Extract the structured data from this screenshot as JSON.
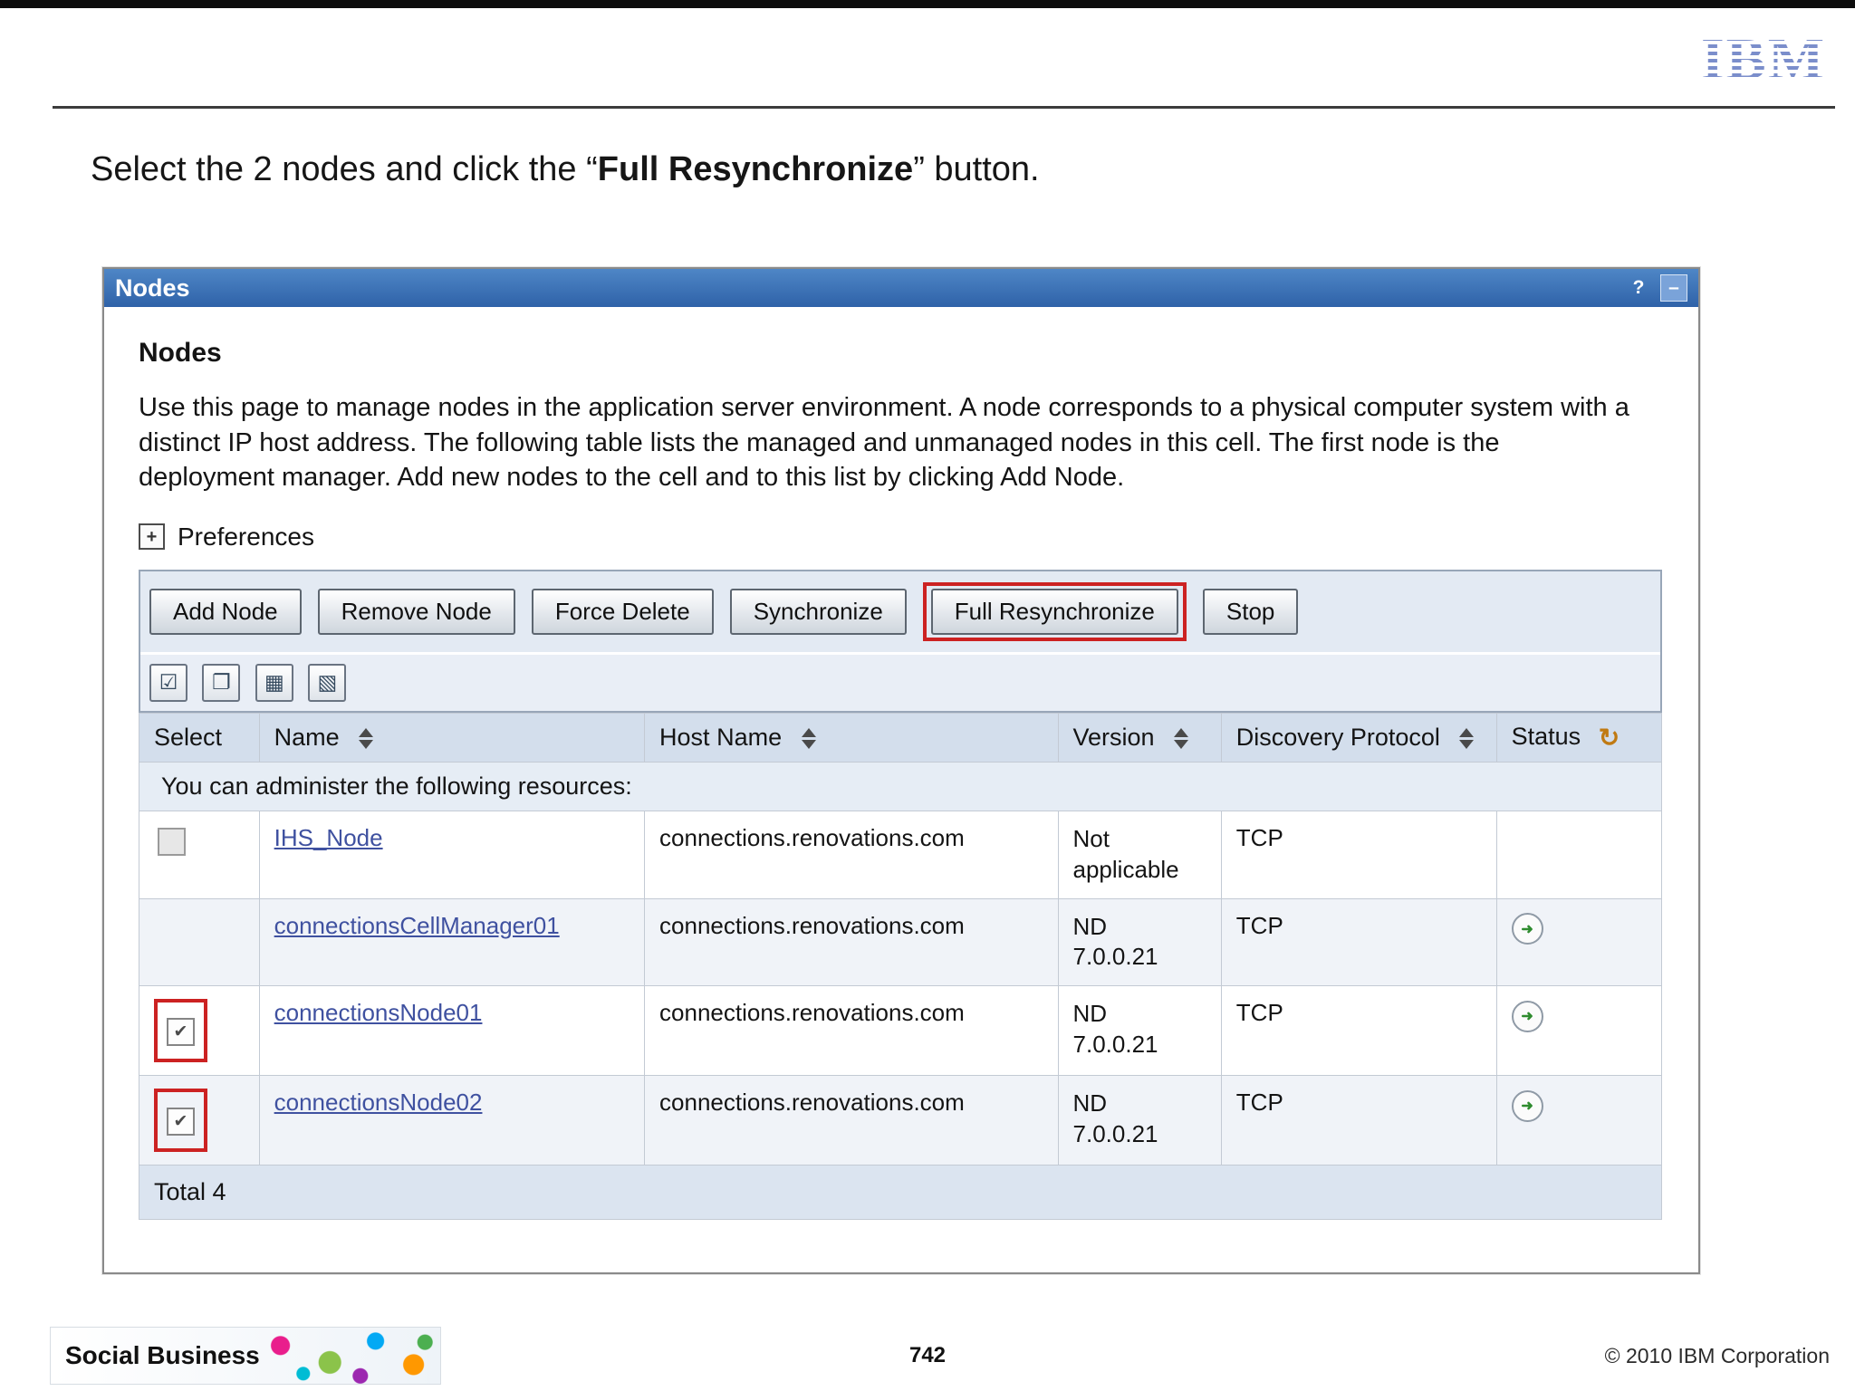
{
  "slide": {
    "ibm_logo": "IBM",
    "title_prefix": "Select the 2 nodes and click the “",
    "title_bold": "Full Resynchronize",
    "title_suffix": "” button.",
    "footer": {
      "brand": "Social Business",
      "page_number": "742",
      "copyright": "© 2010 IBM Corporation"
    }
  },
  "icons": {
    "help": "?",
    "minimize": "–",
    "expand": "+",
    "check": "✔",
    "refresh": "↻",
    "status_arrow": "➜",
    "select_all": "☑",
    "deselect_all": "❐",
    "show_filter": "▦",
    "clear_filter": "▧"
  },
  "panel": {
    "titlebar_title": "Nodes",
    "heading": "Nodes",
    "description": "Use this page to manage nodes in the application server environment. A node corresponds to a physical computer system with a distinct IP host address. The following table lists the managed and unmanaged nodes in this cell. The first node is the deployment manager. Add new nodes to the cell and to this list by clicking Add Node.",
    "preferences_label": "Preferences",
    "buttons": [
      "Add Node",
      "Remove Node",
      "Force Delete",
      "Synchronize",
      "Full Resynchronize",
      "Stop"
    ],
    "highlighted_button": "Full Resynchronize",
    "accent_colors": {
      "titlebar_blue": "#3a72b9",
      "highlight_red": "#cc2222",
      "link_blue": "#3f51a0"
    },
    "table": {
      "columns": [
        "Select",
        "Name",
        "Host Name",
        "Version",
        "Discovery Protocol",
        "Status"
      ],
      "admin_caption": "You can administer the following resources:",
      "rows": [
        {
          "checkbox": "unchecked",
          "name": "IHS_Node",
          "host": "connections.renovations.com",
          "version": [
            "Not",
            "applicable"
          ],
          "protocol": "TCP",
          "status": false,
          "highlighted": false
        },
        {
          "checkbox": "none",
          "name": "connectionsCellManager01",
          "host": "connections.renovations.com",
          "version": [
            "ND",
            "7.0.0.21"
          ],
          "protocol": "TCP",
          "status": true,
          "highlighted": false
        },
        {
          "checkbox": "checked",
          "name": "connectionsNode01",
          "host": "connections.renovations.com",
          "version": [
            "ND",
            "7.0.0.21"
          ],
          "protocol": "TCP",
          "status": true,
          "highlighted": true
        },
        {
          "checkbox": "checked",
          "name": "connectionsNode02",
          "host": "connections.renovations.com",
          "version": [
            "ND",
            "7.0.0.21"
          ],
          "protocol": "TCP",
          "status": true,
          "highlighted": true
        }
      ],
      "total": "Total 4"
    }
  }
}
